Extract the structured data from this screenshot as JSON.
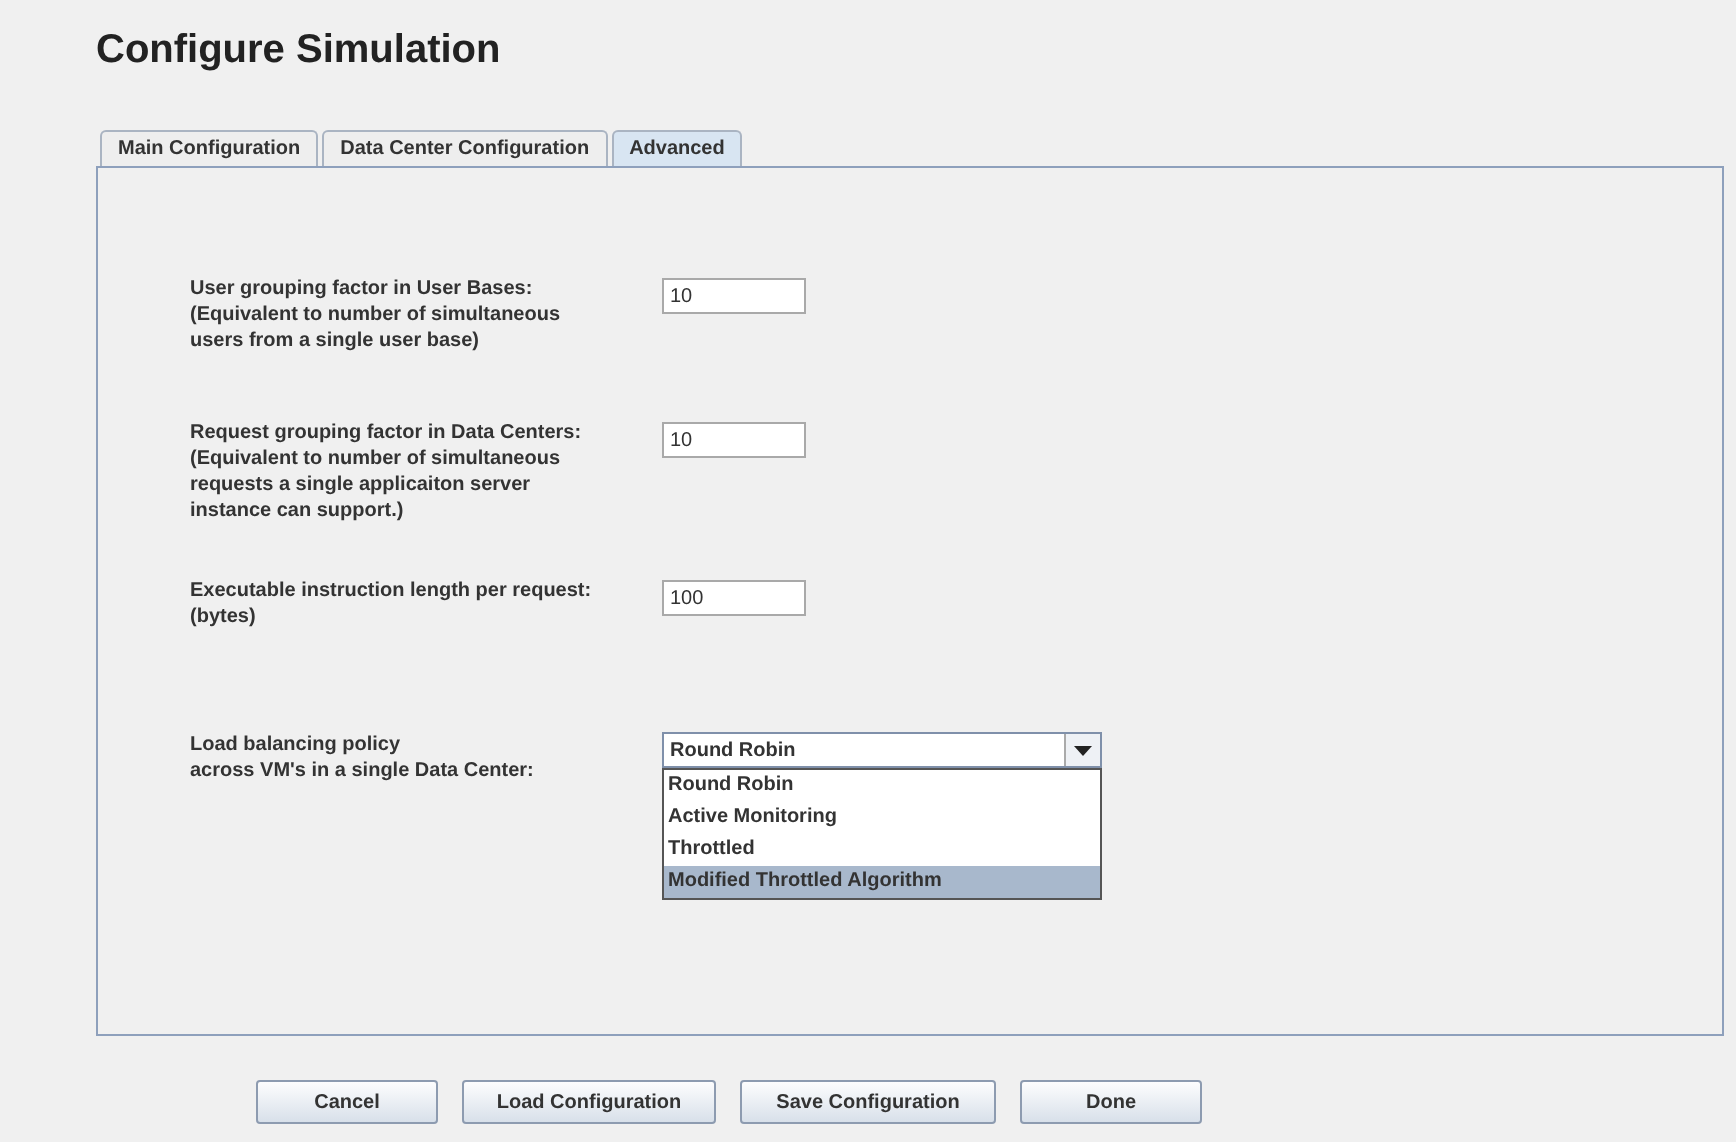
{
  "title": "Configure Simulation",
  "tabs": [
    {
      "label": "Main Configuration",
      "selected": false
    },
    {
      "label": "Data Center Configuration",
      "selected": false
    },
    {
      "label": "Advanced",
      "selected": true
    }
  ],
  "fields": [
    {
      "label_lines": [
        "User grouping factor in User Bases:",
        "(Equivalent to number of simultaneous",
        "users from a single user base)"
      ],
      "value": "10"
    },
    {
      "label_lines": [
        "Request grouping factor in Data Centers:",
        "(Equivalent to number of simultaneous",
        "requests a single applicaiton server",
        "instance can support.)"
      ],
      "value": "10"
    },
    {
      "label_lines": [
        "Executable instruction length per request:",
        "(bytes)"
      ],
      "value": "100"
    }
  ],
  "policy": {
    "label_lines": [
      "Load balancing policy",
      "across VM's in a single Data Center:"
    ],
    "value": "Round Robin",
    "expanded": true,
    "options": [
      {
        "label": "Round Robin",
        "highlighted": false
      },
      {
        "label": "Active Monitoring",
        "highlighted": false
      },
      {
        "label": "Throttled",
        "highlighted": false
      },
      {
        "label": "Modified Throttled Algorithm",
        "highlighted": true
      }
    ]
  },
  "buttons": [
    "Cancel",
    "Load Configuration",
    "Save Configuration",
    "Done"
  ]
}
